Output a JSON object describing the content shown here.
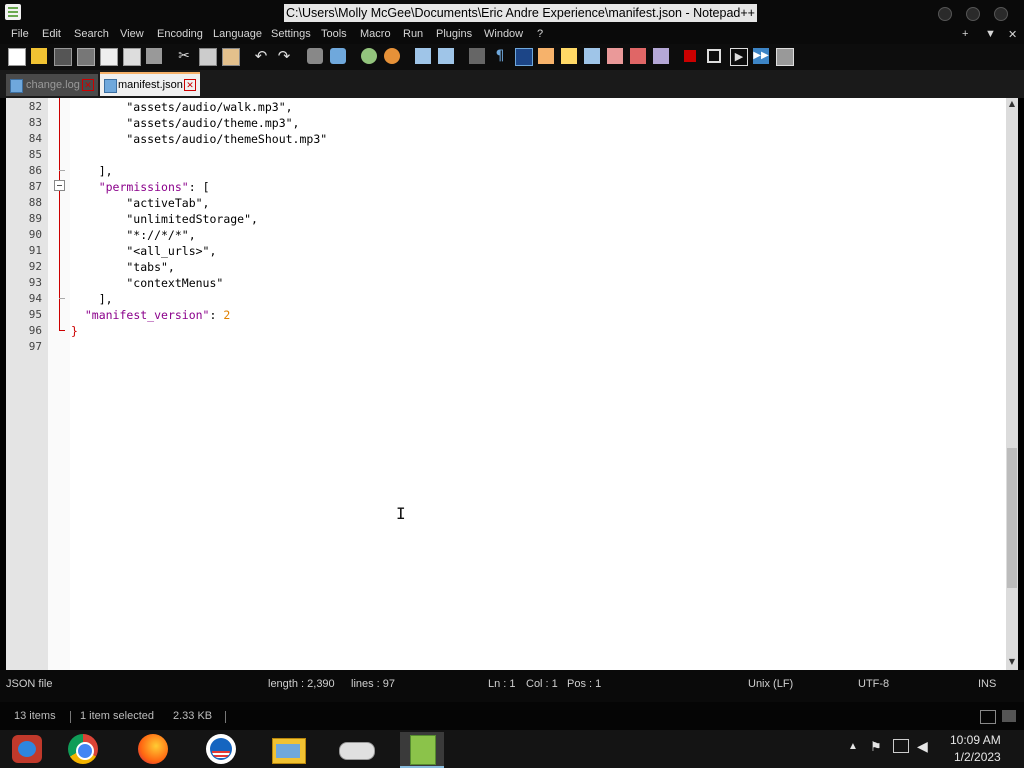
{
  "window": {
    "title": "C:\\Users\\Molly McGee\\Documents\\Eric Andre Experience\\manifest.json - Notepad++",
    "menu": [
      "File",
      "Edit",
      "Search",
      "View",
      "Encoding",
      "Language",
      "Settings",
      "Tools",
      "Macro",
      "Run",
      "Plugins",
      "Window",
      "?"
    ],
    "menu_right": [
      "+",
      "▼",
      "✕"
    ]
  },
  "tabs": [
    {
      "label": "change.log",
      "active": false
    },
    {
      "label": "manifest.json",
      "active": true
    }
  ],
  "editor": {
    "lines": [
      {
        "n": "82",
        "text": "        \"assets/audio/walk.mp3\","
      },
      {
        "n": "83",
        "text": "        \"assets/audio/theme.mp3\","
      },
      {
        "n": "84",
        "text": "        \"assets/audio/themeShout.mp3\""
      },
      {
        "n": "85",
        "text": ""
      },
      {
        "n": "86",
        "text": "    ],"
      },
      {
        "n": "87",
        "text": "    \"permissions\": ["
      },
      {
        "n": "88",
        "text": "        \"activeTab\","
      },
      {
        "n": "89",
        "text": "        \"unlimitedStorage\","
      },
      {
        "n": "90",
        "text": "        \"*://*/*\","
      },
      {
        "n": "91",
        "text": "        \"<all_urls>\","
      },
      {
        "n": "92",
        "text": "        \"tabs\","
      },
      {
        "n": "93",
        "text": "        \"contextMenus\""
      },
      {
        "n": "94",
        "text": "    ],"
      },
      {
        "n": "95",
        "text": "  \"manifest_version\": 2"
      },
      {
        "n": "96",
        "text": "}"
      },
      {
        "n": "97",
        "text": ""
      }
    ]
  },
  "status": {
    "filetype": "JSON file",
    "length": "length : 2,390",
    "lines": "lines : 97",
    "ln": "Ln : 1",
    "col": "Col : 1",
    "pos": "Pos : 1",
    "eol": "Unix (LF)",
    "encoding": "UTF-8",
    "mode": "INS"
  },
  "explorer": {
    "items": "13 items",
    "selected": "1 item selected",
    "size": "2.33 KB"
  },
  "clock": {
    "time": "10:09 AM",
    "date": "1/2/2023"
  },
  "taskbar_icons": [
    "windows-media-icon",
    "chrome-icon",
    "firefox-icon",
    "obama-icon",
    "file-explorer-icon",
    "gamepad-icon",
    "notepadpp-icon"
  ]
}
